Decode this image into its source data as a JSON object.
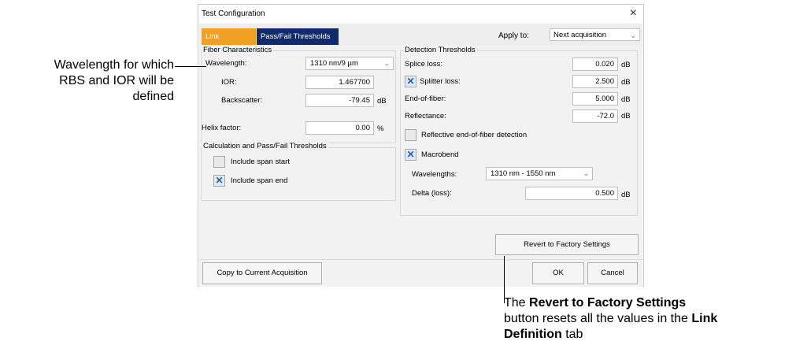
{
  "dialog": {
    "title": "Test Configuration",
    "close_glyph": "×",
    "tabs": [
      {
        "label": "Link Definition",
        "active": true
      },
      {
        "label": "Pass/Fail Thresholds",
        "active": false
      }
    ],
    "apply_to": {
      "label": "Apply to:",
      "value": "Next acquisition"
    }
  },
  "fiber": {
    "title": "Fiber Characteristics",
    "wavelength": {
      "label": "Wavelength:",
      "value": "1310 nm/9 µm"
    },
    "ior": {
      "label": "IOR:",
      "value": "1.467700"
    },
    "backscatter": {
      "label": "Backscatter:",
      "value": "-79.45",
      "unit": "dB"
    },
    "helix": {
      "label": "Helix factor:",
      "value": "0.00",
      "unit": "%"
    }
  },
  "calc": {
    "title": "Calculation and Pass/Fail Thresholds",
    "include_span_start": {
      "label": "Include span start",
      "checked": false
    },
    "include_span_end": {
      "label": "Include span end",
      "checked": true
    }
  },
  "detection": {
    "title": "Detection Thresholds",
    "splice": {
      "label": "Splice loss:",
      "value": "0.020",
      "unit": "dB"
    },
    "splitter": {
      "label": "Splitter loss:",
      "value": "2.500",
      "unit": "dB",
      "checked": true
    },
    "eof": {
      "label": "End-of-fiber:",
      "value": "5.000",
      "unit": "dB"
    },
    "reflectance": {
      "label": "Reflectance:",
      "value": "-72.0",
      "unit": "dB"
    },
    "reflective_eof": {
      "label": "Reflective end-of-fiber detection",
      "checked": false
    },
    "macrobend": {
      "label": "Macrobend",
      "checked": true
    },
    "wavelengths": {
      "label": "Wavelengths:",
      "value": "1310 nm - 1550 nm"
    },
    "delta": {
      "label": "Delta (loss):",
      "value": "0.500",
      "unit": "dB"
    }
  },
  "buttons": {
    "revert": "Revert to Factory Settings",
    "copy": "Copy to Current Acquisition",
    "ok": "OK",
    "cancel": "Cancel"
  },
  "annotations": {
    "left_line1": "Wavelength for which",
    "left_line2": "RBS and IOR will be",
    "left_line3": "defined",
    "bottom_line1_a": "The ",
    "bottom_line1_b": "Revert to Factory Settings",
    "bottom_line2_a": "button resets all the values in the ",
    "bottom_line2_b": "Link",
    "bottom_line3_a": "Definition",
    "bottom_line3_b": " tab"
  },
  "icons": {
    "check": "✕",
    "chevron": "⌄"
  }
}
